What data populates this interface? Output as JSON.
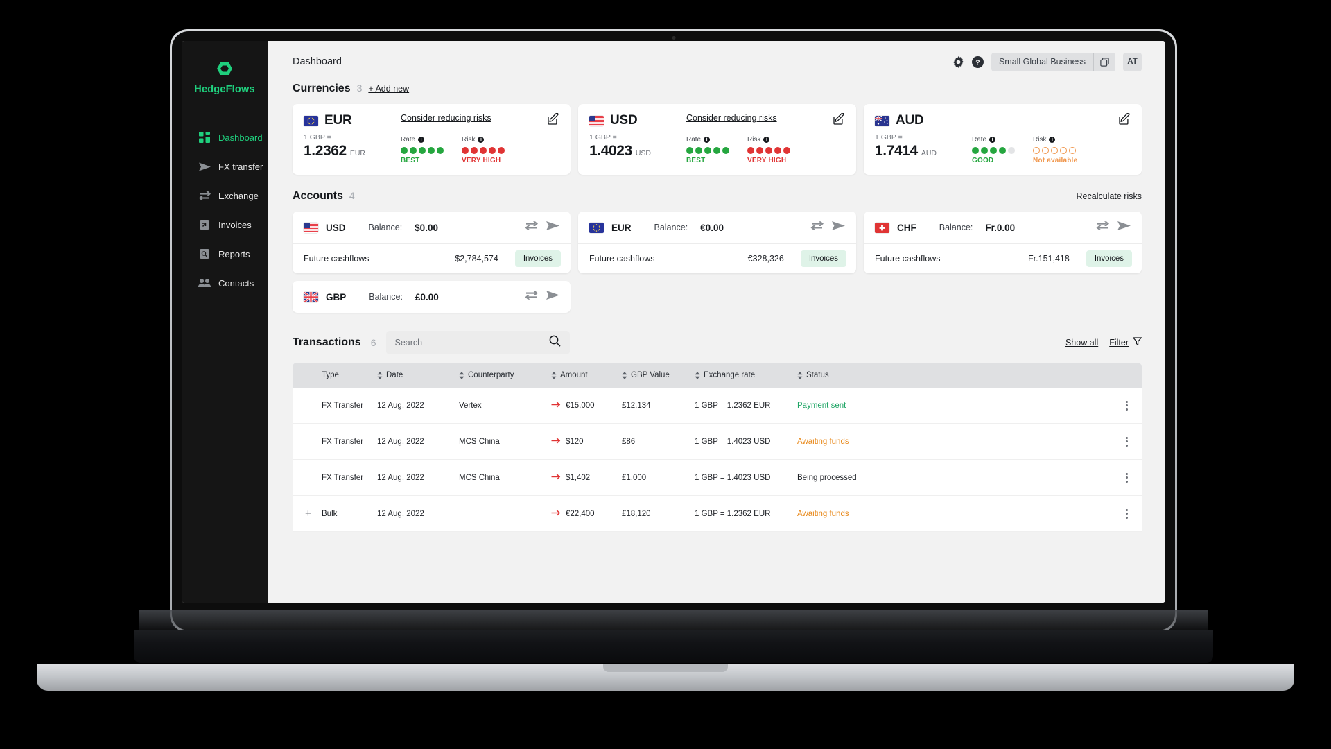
{
  "brand": {
    "name": "HedgeFlows"
  },
  "sidebar": {
    "items": [
      {
        "label": "Dashboard",
        "icon": "grid-icon",
        "active": true
      },
      {
        "label": "FX transfer",
        "icon": "send-icon",
        "active": false
      },
      {
        "label": "Exchange",
        "icon": "exchange-icon",
        "active": false
      },
      {
        "label": "Invoices",
        "icon": "invoice-icon",
        "active": false
      },
      {
        "label": "Reports",
        "icon": "reports-icon",
        "active": false
      },
      {
        "label": "Contacts",
        "icon": "contacts-icon",
        "active": false
      }
    ]
  },
  "topbar": {
    "page_title": "Dashboard",
    "settings_icon": "gear-icon",
    "help_icon": "help-icon",
    "org_name": "Small Global Business",
    "copy_icon": "copy-icon",
    "avatar_initials": "AT"
  },
  "currencies": {
    "title": "Currencies",
    "count": "3",
    "add_new": "+ Add new",
    "cards": [
      {
        "code": "EUR",
        "flag": "eu-flag",
        "sub": "1 GBP =",
        "rate": "1.2362",
        "rate_currency": "EUR",
        "action": "Consider reducing risks",
        "edit_icon": "edit-icon",
        "rate_label": "Rate",
        "rate_dots_filled": 5,
        "rate_color": "#25a63f",
        "rate_caption": "BEST",
        "risk_label": "Risk",
        "risk_dots_filled": 5,
        "risk_color": "#e03434",
        "risk_caption": "VERY HIGH"
      },
      {
        "code": "USD",
        "flag": "us-flag",
        "sub": "1 GBP =",
        "rate": "1.4023",
        "rate_currency": "USD",
        "action": "Consider reducing risks",
        "edit_icon": "edit-icon",
        "rate_label": "Rate",
        "rate_dots_filled": 5,
        "rate_color": "#25a63f",
        "rate_caption": "BEST",
        "risk_label": "Risk",
        "risk_dots_filled": 5,
        "risk_color": "#e03434",
        "risk_caption": "VERY HIGH"
      },
      {
        "code": "AUD",
        "flag": "au-flag",
        "sub": "1 GBP =",
        "rate": "1.7414",
        "rate_currency": "AUD",
        "action": "",
        "edit_icon": "edit-icon",
        "rate_label": "Rate",
        "rate_dots_filled": 4,
        "rate_color": "#25a63f",
        "rate_caption": "GOOD",
        "risk_label": "Risk",
        "risk_dots_filled": 0,
        "risk_color": "#f0954a",
        "risk_caption": "Not available"
      }
    ]
  },
  "accounts": {
    "title": "Accounts",
    "count": "4",
    "recalculate": "Recalculate risks",
    "balance_label": "Balance:",
    "future_label": "Future cashflows",
    "invoices_label": "Invoices",
    "exchange_icon": "exchange-icon",
    "send_icon": "send-icon",
    "items": [
      {
        "code": "USD",
        "flag": "us-flag",
        "balance": "$0.00",
        "future": "-$2,784,574",
        "has_future": true
      },
      {
        "code": "EUR",
        "flag": "eu-flag",
        "balance": "€0.00",
        "future": "-€328,326",
        "has_future": true
      },
      {
        "code": "CHF",
        "flag": "ch-flag",
        "balance": "Fr.0.00",
        "future": "-Fr.151,418",
        "has_future": true
      },
      {
        "code": "GBP",
        "flag": "gb-flag",
        "balance": "£0.00",
        "future": "",
        "has_future": false
      }
    ]
  },
  "transactions": {
    "title": "Transactions",
    "count": "6",
    "search_placeholder": "Search",
    "search_value": "",
    "search_icon": "search-icon",
    "show_all": "Show all",
    "filter": "Filter",
    "filter_icon": "filter-icon",
    "columns": [
      "Type",
      "Date",
      "Counterparty",
      "Amount",
      "GBP Value",
      "Exchange rate",
      "Status"
    ],
    "rows": [
      {
        "expand": "",
        "type": "FX Transfer",
        "date": "12 Aug, 2022",
        "counterparty": "Vertex",
        "amount": "€15,000",
        "gbp": "£12,134",
        "rate": "1 GBP = 1.2362 EUR",
        "status": "Payment sent",
        "status_style": "green"
      },
      {
        "expand": "",
        "type": "FX Transfer",
        "date": "12 Aug, 2022",
        "counterparty": "MCS China",
        "amount": "$120",
        "gbp": "£86",
        "rate": "1 GBP = 1.4023 USD",
        "status": "Awaiting funds",
        "status_style": "amber"
      },
      {
        "expand": "",
        "type": "FX Transfer",
        "date": "12 Aug, 2022",
        "counterparty": "MCS China",
        "amount": "$1,402",
        "gbp": "£1,000",
        "rate": "1 GBP = 1.4023 USD",
        "status": "Being processed",
        "status_style": "dark"
      },
      {
        "expand": "+",
        "type": "Bulk",
        "date": "12 Aug, 2022",
        "counterparty": "",
        "amount": "€22,400",
        "gbp": "£18,120",
        "rate": "1 GBP = 1.2362 EUR",
        "status": "Awaiting funds",
        "status_style": "amber"
      }
    ]
  },
  "colors": {
    "brand_green": "#1fcf7d",
    "status_green": "#1fa565",
    "status_amber": "#e8891b",
    "risk_red": "#e03434"
  }
}
